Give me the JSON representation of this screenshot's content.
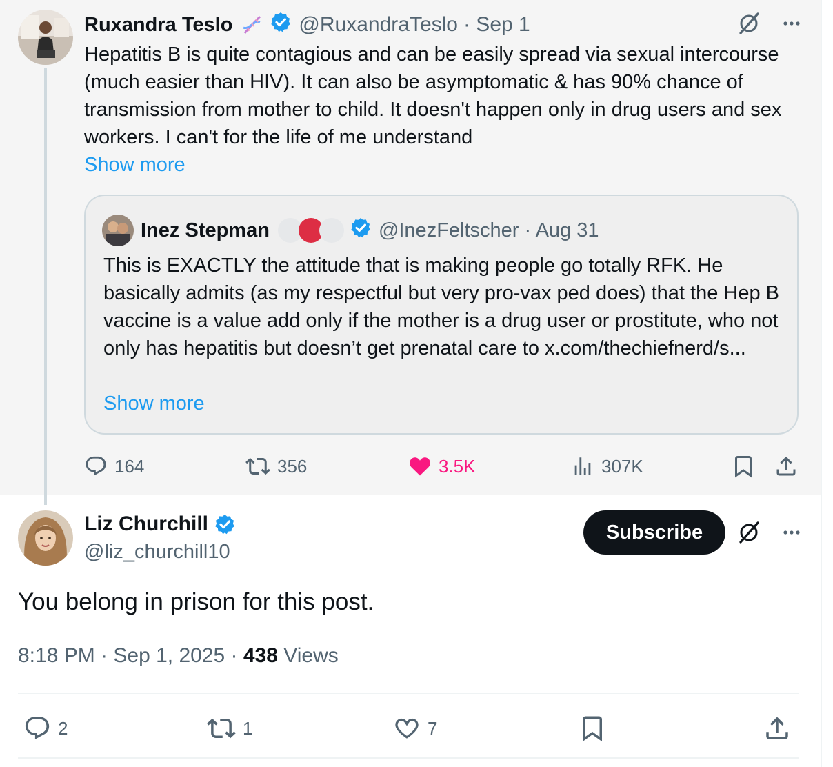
{
  "parent": {
    "name": "Ruxandra Teslo",
    "handle": "@RuxandraTeslo",
    "date": "· Sep 1",
    "text": "Hepatitis B is quite contagious and can be easily spread via sexual intercourse (much easier than HIV). It can also be asymptomatic & has 90% chance of transmission from mother to child. It doesn't happen only in drug users and sex workers. I can't for the life of me understand",
    "show_more": "Show more",
    "quote": {
      "name": "Inez Stepman",
      "handle": "@InezFeltscher",
      "date": "· Aug 31",
      "text": "This is EXACTLY the attitude that is making people go totally RFK. He basically admits (as my respectful but very pro-vax ped does) that the Hep B vaccine is a value add only if the mother is a drug user or prostitute, who not only has hepatitis but doesn’t get prenatal care to x.com/thechiefnerd/s...",
      "show_more": "Show more"
    },
    "stats": {
      "replies": "164",
      "reposts": "356",
      "likes": "3.5K",
      "views": "307K"
    }
  },
  "reply": {
    "name": "Liz Churchill",
    "handle": "@liz_churchill10",
    "subscribe_label": "Subscribe",
    "text": "You belong in prison for this post.",
    "time": "8:18 PM · Sep 1, 2025 · ",
    "views_count": "438",
    "views_label": " Views",
    "stats": {
      "replies": "2",
      "reposts": "1",
      "likes": "7"
    }
  },
  "colors": {
    "verified": "#1d9bf0",
    "like_active": "#f91880",
    "link": "#1d9bf0",
    "muted": "#536471"
  },
  "icons": [
    "dna-icon",
    "verified-badge-icon",
    "grok-icon",
    "more-icon",
    "reply-icon",
    "repost-icon",
    "like-icon",
    "views-icon",
    "bookmark-icon",
    "share-icon"
  ]
}
